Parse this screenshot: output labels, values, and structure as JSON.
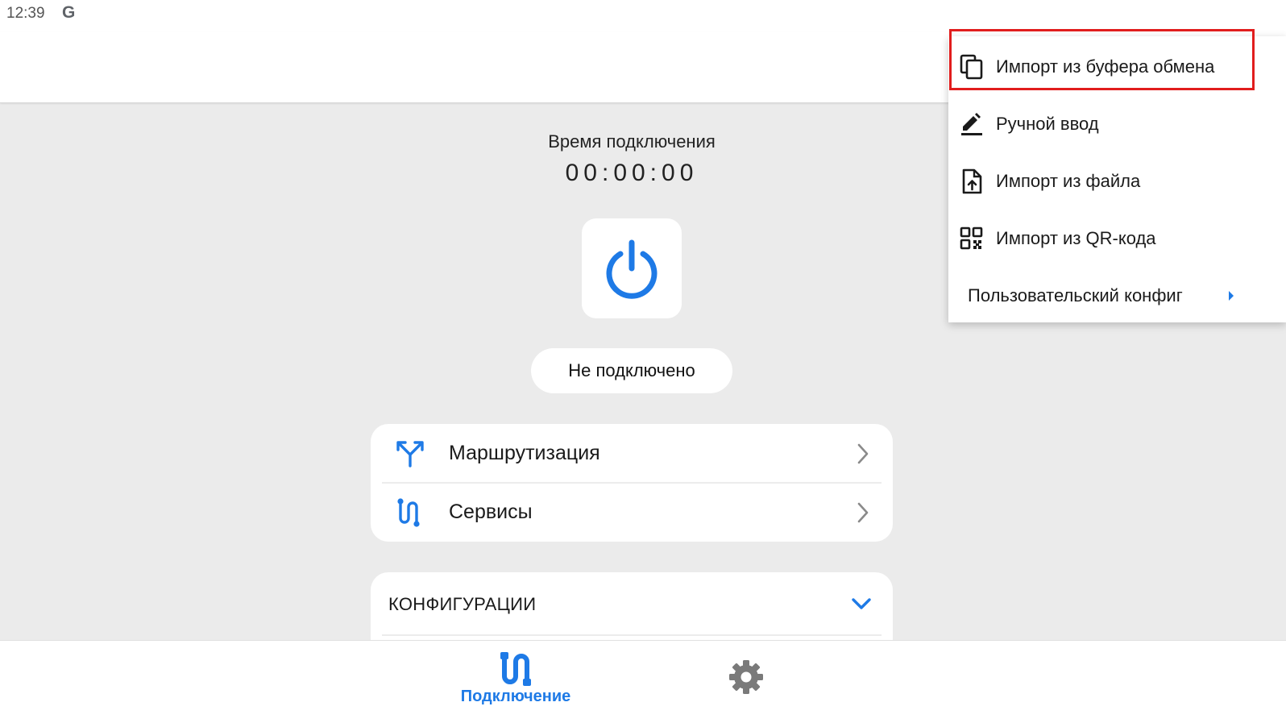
{
  "status_bar": {
    "time": "12:39",
    "g_icon_letter": "G"
  },
  "connection": {
    "time_label": "Время подключения",
    "time_value": "00:00:00",
    "status": "Не подключено"
  },
  "nav_card": {
    "routing_label": "Маршрутизация",
    "services_label": "Сервисы"
  },
  "configs": {
    "title": "КОНФИГУРАЦИИ"
  },
  "bottom_nav": {
    "connection_label": "Подключение"
  },
  "menu": {
    "items": [
      {
        "label": "Импорт из буфера обмена",
        "icon": "clipboard-copy-icon"
      },
      {
        "label": "Ручной ввод",
        "icon": "edit-pen-icon"
      },
      {
        "label": "Импорт из файла",
        "icon": "file-upload-icon"
      },
      {
        "label": "Импорт из QR-кода",
        "icon": "qr-code-icon"
      },
      {
        "label": "Пользовательский конфиг",
        "icon": "chevron-right-icon"
      }
    ]
  },
  "colors": {
    "accent": "#1e7ae6",
    "highlight": "#e11d1d",
    "background": "#ebebeb"
  }
}
